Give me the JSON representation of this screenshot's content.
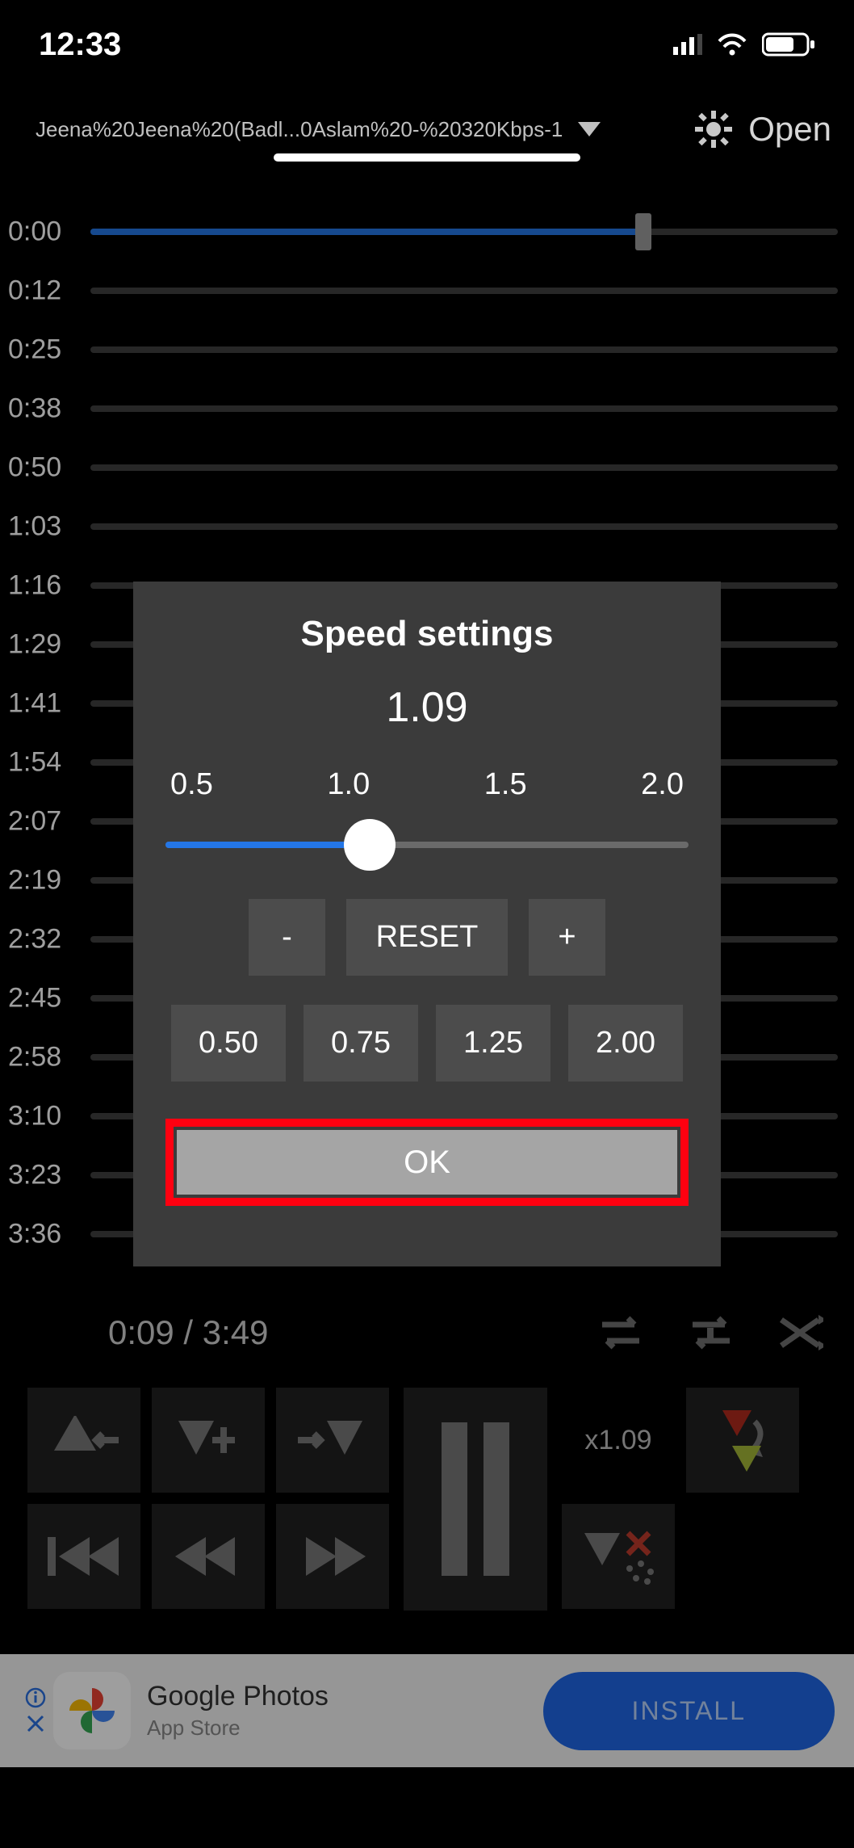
{
  "status": {
    "time": "12:33"
  },
  "header": {
    "filename": "Jeena%20Jeena%20(Badl...0Aslam%20-%20320Kbps-1",
    "open": "Open"
  },
  "timeline": {
    "rows": [
      {
        "label": "0:00",
        "fill_pct": 74,
        "thumb_pct": 74
      },
      {
        "label": "0:12"
      },
      {
        "label": "0:25"
      },
      {
        "label": "0:38"
      },
      {
        "label": "0:50"
      },
      {
        "label": "1:03"
      },
      {
        "label": "1:16"
      },
      {
        "label": "1:29"
      },
      {
        "label": "1:41"
      },
      {
        "label": "1:54"
      },
      {
        "label": "2:07"
      },
      {
        "label": "2:19"
      },
      {
        "label": "2:32"
      },
      {
        "label": "2:45"
      },
      {
        "label": "2:58"
      },
      {
        "label": "3:10"
      },
      {
        "label": "3:23"
      },
      {
        "label": "3:36"
      }
    ]
  },
  "playback": {
    "time": "0:09 / 3:49",
    "speed_label": "x1.09"
  },
  "dialog": {
    "title": "Speed settings",
    "value": "1.09",
    "tick_labels": [
      "0.5",
      "1.0",
      "1.5",
      "2.0"
    ],
    "slider_pct": 39,
    "minus": "-",
    "reset": "RESET",
    "plus": "+",
    "presets": [
      "0.50",
      "0.75",
      "1.25",
      "2.00"
    ],
    "ok": "OK"
  },
  "ad": {
    "title": "Google Photos",
    "subtitle": "App Store",
    "cta": "INSTALL"
  }
}
